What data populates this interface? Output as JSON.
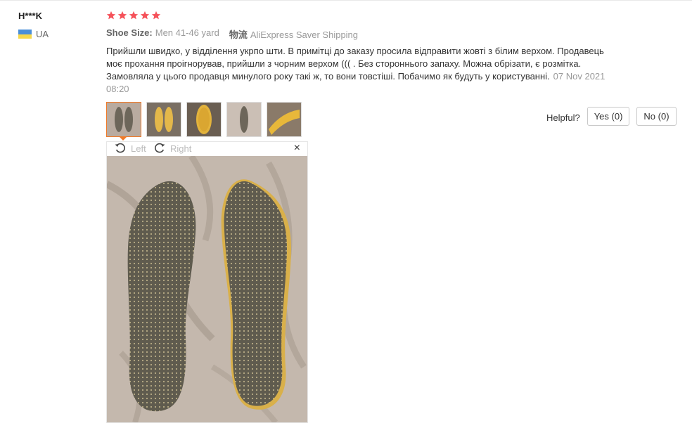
{
  "reviewer": {
    "name": "H***K",
    "country": "UA"
  },
  "rating": {
    "stars": 5,
    "color": "#f5525a"
  },
  "meta": {
    "size_label": "Shoe Size:",
    "size_value": "Men 41-46 yard",
    "shipping_label": "物流",
    "shipping_value": "AliExpress Saver Shipping"
  },
  "review": {
    "text": "Прийшли швидко, у відділення укрпо шти. В примітці до заказу просила відправити жовті з білим верхом. Продавець моє прохання проігнорував, прийшли з чорним верхом ((( . Без стороннього запаху. Можна обрізати, є розмітка. Замовляла у цього продавця минулого року такі ж, то вони товстіші. Побачимо як будуть у користуванні.",
    "date": "07 Nov 2021 08:20"
  },
  "thumbnails": [
    {
      "name": "photo-1",
      "active": true
    },
    {
      "name": "photo-2",
      "active": false
    },
    {
      "name": "photo-3",
      "active": false
    },
    {
      "name": "photo-4",
      "active": false
    },
    {
      "name": "photo-5",
      "active": false
    }
  ],
  "viewer": {
    "rotate_left": "Left",
    "rotate_right": "Right",
    "close": "×"
  },
  "helpful": {
    "question": "Helpful?",
    "yes": "Yes (0)",
    "no": "No (0)"
  },
  "colors": {
    "accent": "#f07a28",
    "flag_blue": "#4a8fd8",
    "flag_yellow": "#f6d84a"
  }
}
